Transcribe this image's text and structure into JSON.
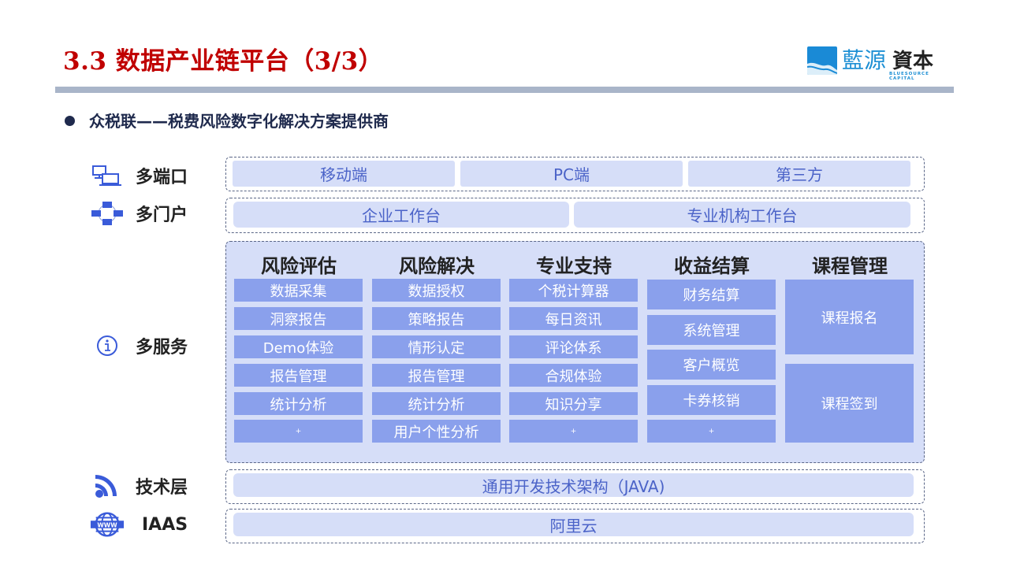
{
  "header": {
    "title": "3.3 数据产业链平台（3/3）",
    "logo": {
      "cn_main": "藍源",
      "cn_sub": "資本",
      "en": "BLUESOURCE CAPITAL"
    }
  },
  "subtitle": "众税联——税费风险数字化解决方案提供商",
  "colors": {
    "title_red": "#c00000",
    "cell_light": "#d6def8",
    "cell_text": "#4b63c8",
    "item_fill": "#8aa0ec",
    "icon_blue": "#3a5bd9",
    "rule_gray": "#a9b5c9"
  },
  "layers": {
    "terminals": {
      "label": "多端口",
      "icon": "devices-icon",
      "cells": [
        "移动端",
        "PC端",
        "第三方"
      ]
    },
    "portals": {
      "label": "多门户",
      "icon": "network-icon",
      "cells": [
        "企业工作台",
        "专业机构工作台"
      ]
    },
    "services": {
      "label": "多服务",
      "icon": "info-icon",
      "columns": [
        {
          "title": "风险评估",
          "items": [
            "数据采集",
            "洞察报告",
            "Demo体验",
            "报告管理",
            "统计分析",
            "+"
          ]
        },
        {
          "title": "风险解决",
          "items": [
            "数据授权",
            "策略报告",
            "情形认定",
            "报告管理",
            "统计分析",
            "用户个性分析"
          ]
        },
        {
          "title": "专业支持",
          "items": [
            "个税计算器",
            "每日资讯",
            "评论体系",
            "合规体验",
            "知识分享",
            "+"
          ]
        },
        {
          "title": "收益结算",
          "items": [
            "财务结算",
            "系统管理",
            "客户概览",
            "卡券核销",
            "+"
          ]
        },
        {
          "title": "课程管理",
          "items": [
            "课程报名",
            "课程签到"
          ]
        }
      ]
    },
    "tech": {
      "label": "技术层",
      "icon": "rss-icon",
      "cells": [
        "通用开发技术架构（JAVA)"
      ]
    },
    "iaas": {
      "label": "IAAS",
      "icon": "www-globe-icon",
      "cells": [
        "阿里云"
      ]
    }
  }
}
